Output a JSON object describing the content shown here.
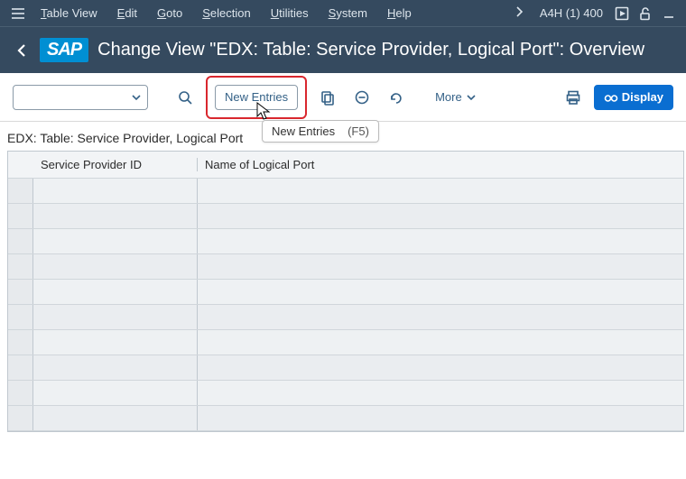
{
  "menubar": {
    "items": [
      {
        "underline": "T",
        "rest": "able View"
      },
      {
        "underline": "E",
        "rest": "dit"
      },
      {
        "underline": "G",
        "rest": "oto"
      },
      {
        "underline": "S",
        "rest": "election"
      },
      {
        "underline": "U",
        "rest": "tilities"
      },
      {
        "underline": "S",
        "rest": "ystem"
      },
      {
        "underline": "H",
        "rest": "elp"
      }
    ],
    "system_id": "A4H (1) 400"
  },
  "titlebar": {
    "logo": "SAP",
    "title": "Change View \"EDX: Table: Service Provider, Logical Port\": Overview"
  },
  "toolbar": {
    "new_entries": "New Entries",
    "more": "More",
    "display": "Display"
  },
  "tooltip": {
    "label": "New Entries",
    "shortcut": "(F5)"
  },
  "subtitle": "EDX: Table: Service Provider, Logical Port",
  "table": {
    "columns": {
      "a": "Service Provider ID",
      "b": "Name of Logical Port"
    },
    "rows": 10
  }
}
